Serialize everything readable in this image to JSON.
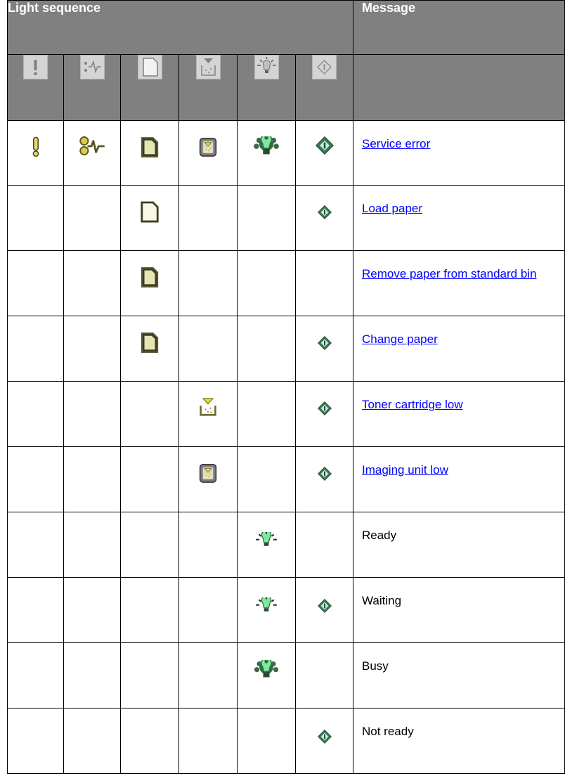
{
  "header": {
    "light_sequence": "Light sequence",
    "message": "Message"
  },
  "icon_columns": [
    "error-icon",
    "paper-jam-icon",
    "load-paper-icon",
    "toner-icon",
    "ready-icon",
    "start-icon"
  ],
  "rows": [
    {
      "message": "Service error",
      "is_link": true
    },
    {
      "message": "Load paper",
      "is_link": true
    },
    {
      "message": "Remove paper from standard bin",
      "is_link": true
    },
    {
      "message": "Change paper",
      "is_link": true
    },
    {
      "message": "Toner cartridge low",
      "is_link": true
    },
    {
      "message": "Imaging unit low",
      "is_link": true
    },
    {
      "message": "Ready",
      "is_link": false
    },
    {
      "message": "Waiting",
      "is_link": false
    },
    {
      "message": "Busy",
      "is_link": false
    },
    {
      "message": "Not ready",
      "is_link": false
    }
  ],
  "colors": {
    "header_bg": "#808080",
    "link": "#0000ff",
    "light_olive": "#c8c870",
    "light_green": "#7de0a0",
    "diamond_green": "#3c7a5a"
  }
}
